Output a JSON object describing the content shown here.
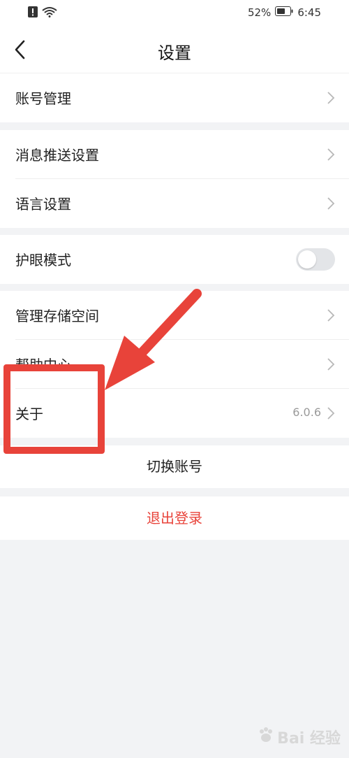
{
  "status_bar": {
    "battery_percent": "52%",
    "time": "6:45"
  },
  "header": {
    "title": "设置"
  },
  "settings": {
    "account": "账号管理",
    "push": "消息推送设置",
    "language": "语言设置",
    "eye_mode": "护眼模式",
    "eye_mode_on": false,
    "storage": "管理存储空间",
    "help": "帮助中心",
    "about": "关于",
    "about_version": "6.0.6"
  },
  "actions": {
    "switch_account": "切换账号",
    "logout": "退出登录"
  },
  "watermark": {
    "text": "Bai 经验"
  },
  "colors": {
    "accent_red": "#e8433a",
    "background": "#f2f3f5"
  }
}
